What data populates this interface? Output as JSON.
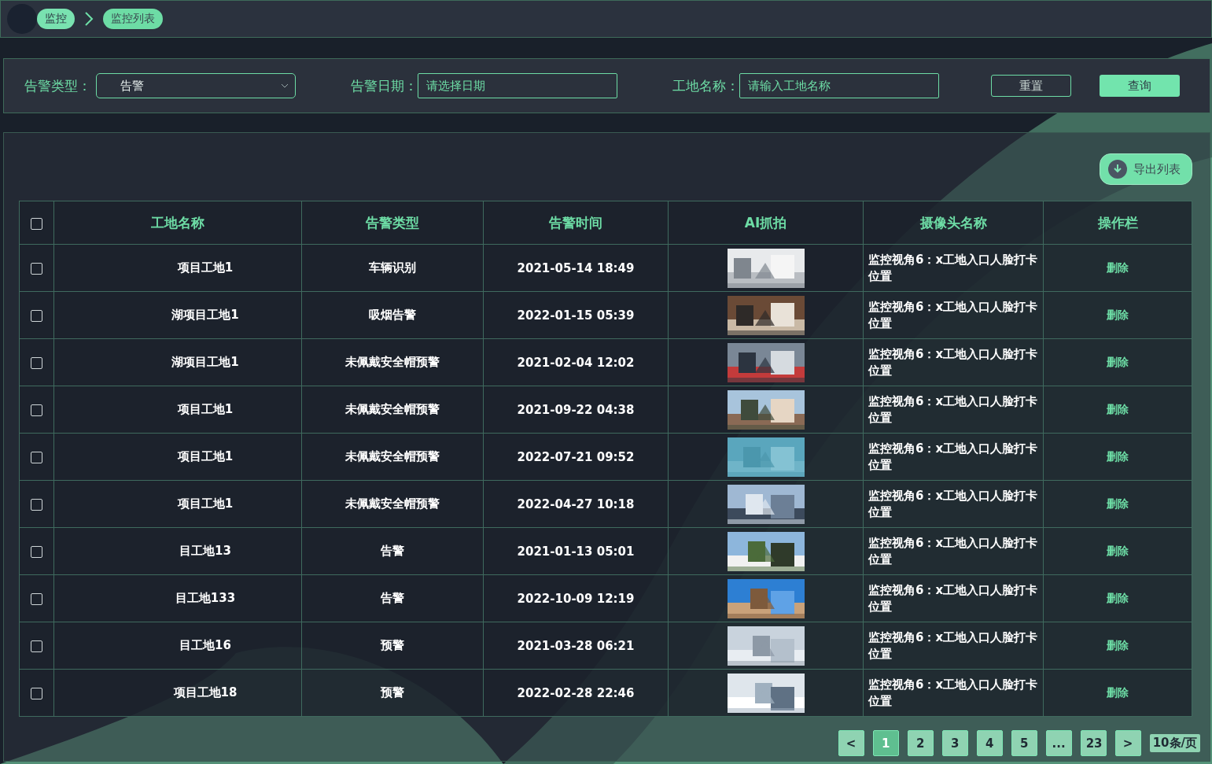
{
  "breadcrumb": [
    {
      "label": "监控",
      "selected": false
    },
    {
      "label": "监控列表",
      "selected": true
    }
  ],
  "filters": {
    "alarm_type": {
      "label": "告警类型：",
      "value": "告警"
    },
    "alarm_date": {
      "label": "告警日期：",
      "placeholder": "请选择日期"
    },
    "site_name": {
      "label": "工地名称：",
      "placeholder": "请输入工地名称"
    },
    "buttons": [
      {
        "label": "重置",
        "kind": "outline"
      },
      {
        "label": "查询",
        "kind": "primary"
      }
    ]
  },
  "export_button": "导出列表",
  "table": {
    "select_all": {
      "checked": false
    },
    "columns": [
      "工地名称",
      "告警类型",
      "告警时间",
      "AI抓拍",
      "摄像头名称",
      "操作栏"
    ],
    "rows": [
      {
        "checked": false,
        "site": "项目工地1",
        "alarm_type": "车辆识别",
        "time": "2021-05-14 18:49",
        "camera": "监控视角6：x工地入口人脸打卡位置",
        "action": "删除"
      },
      {
        "checked": false,
        "site": "湖项目工地1",
        "alarm_type": "吸烟告警",
        "time": "2022-01-15 05:39",
        "camera": "监控视角6：x工地入口人脸打卡位置",
        "action": "删除"
      },
      {
        "checked": false,
        "site": "湖项目工地1",
        "alarm_type": "未佩戴安全帽预警",
        "time": "2021-02-04 12:02",
        "camera": "监控视角6：x工地入口人脸打卡位置",
        "action": "删除"
      },
      {
        "checked": false,
        "site": "项目工地1",
        "alarm_type": "未佩戴安全帽预警",
        "time": "2021-09-22 04:38",
        "camera": "监控视角6：x工地入口人脸打卡位置",
        "action": "删除"
      },
      {
        "checked": false,
        "site": "项目工地1",
        "alarm_type": "未佩戴安全帽预警",
        "time": "2022-07-21 09:52",
        "camera": "监控视角6：x工地入口人脸打卡位置",
        "action": "删除"
      },
      {
        "checked": false,
        "site": "项目工地1",
        "alarm_type": "未佩戴安全帽预警",
        "time": "2022-04-27 10:18",
        "camera": "监控视角6：x工地入口人脸打卡位置",
        "action": "删除"
      },
      {
        "checked": false,
        "site": "目工地13",
        "alarm_type": "告警",
        "time": "2021-01-13 05:01",
        "camera": "监控视角6：x工地入口人脸打卡位置",
        "action": "删除"
      },
      {
        "checked": false,
        "site": "目工地133",
        "alarm_type": "告警",
        "time": "2022-10-09 12:19",
        "camera": "监控视角6：x工地入口人脸打卡位置",
        "action": "删除"
      },
      {
        "checked": false,
        "site": "目工地16",
        "alarm_type": "预警",
        "time": "2021-03-28 06:21",
        "camera": "监控视角6：x工地入口人脸打卡位置",
        "action": "删除"
      },
      {
        "checked": false,
        "site": "项目工地18",
        "alarm_type": "预警",
        "time": "2022-02-28 22:46",
        "camera": "监控视角6：x工地入口人脸打卡位置",
        "action": "删除"
      }
    ]
  },
  "pagination": {
    "prev": "<",
    "pages": [
      {
        "label": "1",
        "selected": true
      },
      {
        "label": "2",
        "selected": false
      },
      {
        "label": "3",
        "selected": false
      },
      {
        "label": "4",
        "selected": false
      },
      {
        "label": "5",
        "selected": false
      },
      {
        "label": "...",
        "selected": false
      },
      {
        "label": "23",
        "selected": false
      }
    ],
    "next": ">",
    "page_size": "10条/页"
  }
}
